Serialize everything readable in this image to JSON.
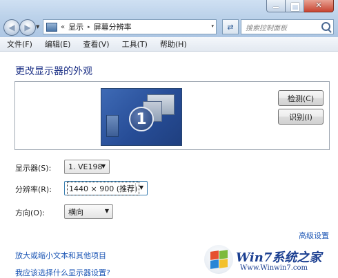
{
  "window": {
    "caption_buttons": {
      "minimize": "minimize-icon",
      "maximize": "maximize-icon",
      "close": "✕"
    }
  },
  "address_bar": {
    "overflow": "«",
    "breadcrumbs": [
      "显示",
      "屏幕分辨率"
    ],
    "separator": "▸",
    "dropdown": "▾"
  },
  "refresh_icon": "⇄",
  "search": {
    "placeholder": "搜索控制面板"
  },
  "menu": [
    "文件(F)",
    "编辑(E)",
    "查看(V)",
    "工具(T)",
    "帮助(H)"
  ],
  "main": {
    "heading": "更改显示器的外观",
    "preview": {
      "monitor_number": "1"
    },
    "buttons": {
      "detect": "检测(C)",
      "identify": "识别(I)"
    },
    "fields": {
      "display": {
        "label": "显示器(S):",
        "value": "1. VE198"
      },
      "resolution": {
        "label": "分辨率(R):",
        "value": "1440 × 900 (推荐)"
      },
      "orientation": {
        "label": "方向(O):",
        "value": "横向"
      }
    },
    "advanced_link": "高级设置",
    "links": [
      "放大或缩小文本和其他项目",
      "我应该选择什么显示器设置?"
    ]
  },
  "watermark": {
    "brand": "Win7系统之家",
    "url": "Www.Winwin7.com"
  },
  "colors": {
    "link": "#1f58b6",
    "heading": "#1e3287",
    "chrome": "#bcd2ea"
  }
}
